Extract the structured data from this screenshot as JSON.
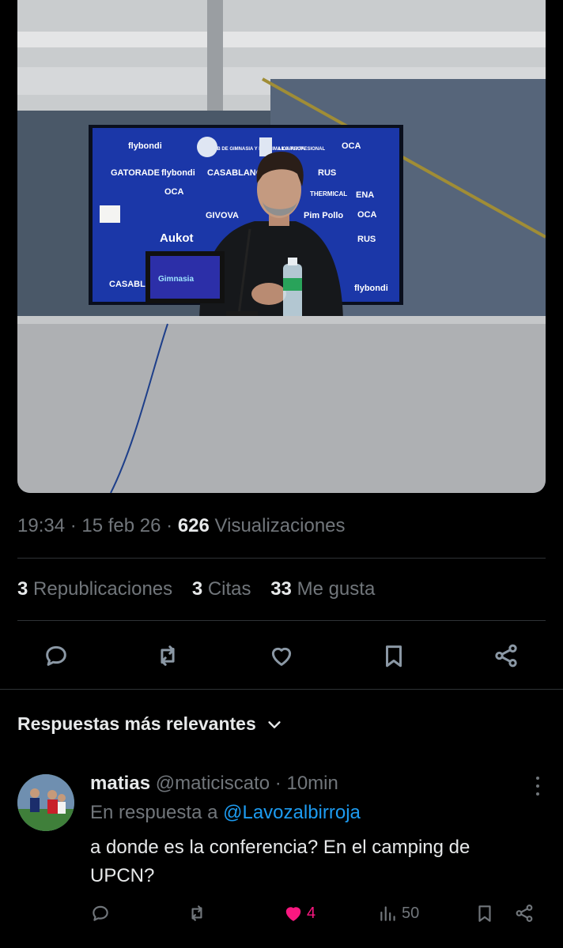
{
  "tweet": {
    "time": "19:34",
    "date": "15 feb 26",
    "views_count": "626",
    "views_label": "Visualizaciones",
    "reposts_count": "3",
    "reposts_label": "Republicaciones",
    "quotes_count": "3",
    "quotes_label": "Citas",
    "likes_count": "33",
    "likes_label": "Me gusta",
    "actions": [
      "reply-icon",
      "repost-icon",
      "like-icon",
      "bookmark-icon",
      "share-icon"
    ]
  },
  "photo": {
    "sponsors": [
      "flybondi",
      "OCA",
      "GATORADE",
      "flybondi",
      "CASABLANCA",
      "RUS",
      "ENA",
      "OCA",
      "Aukot",
      "GIVOVA",
      "Pim Pollo",
      "OCA",
      "RUS",
      "CASABLANCA",
      "flybondi",
      "CLUB DE GIMNASIA Y ESGRIMA LA PLATA",
      "LIGA PROFESIONAL",
      "THERMICAL"
    ]
  },
  "replies_filter": {
    "label": "Respuestas más relevantes"
  },
  "reply": {
    "name": "matias",
    "handle": "@maticiscato",
    "separator": "·",
    "time": "10min",
    "in_reply_prefix": "En respuesta a",
    "in_reply_handle": "@Lavozalbirroja",
    "text": "a donde es la conferencia? En el camping de UPCN?",
    "likes": "4",
    "views": "50",
    "colors": {
      "like": "#f91880",
      "link": "#1d9bf0"
    }
  }
}
